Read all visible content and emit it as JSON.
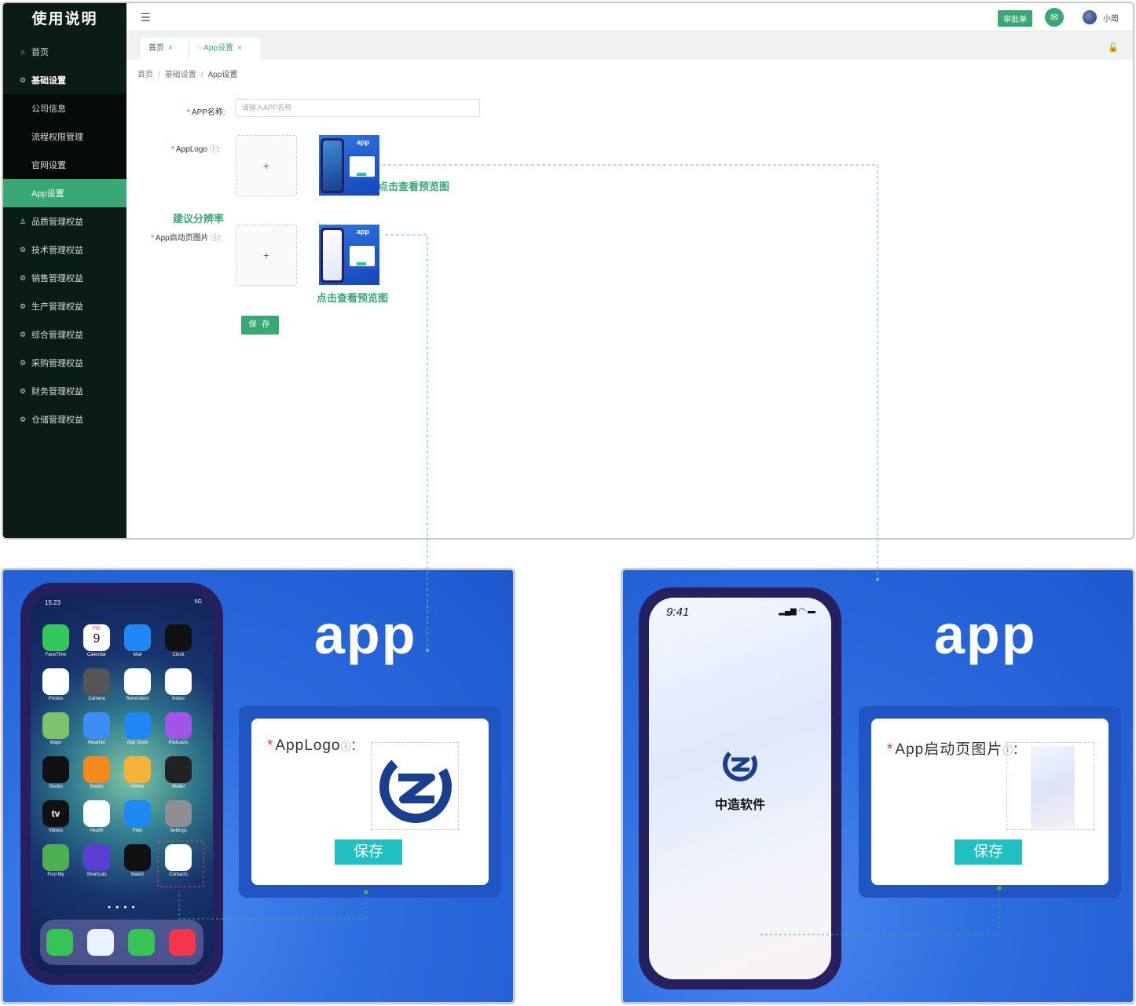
{
  "sidebar": {
    "title": "使用说明",
    "items": [
      {
        "label": "首页",
        "icon": "home-icon"
      },
      {
        "label": "基础设置",
        "icon": "settings-icon"
      },
      {
        "label": "公司信息"
      },
      {
        "label": "流程权限管理"
      },
      {
        "label": "官网设置"
      },
      {
        "label": "App设置"
      },
      {
        "label": "品质管理权益",
        "icon": "user-icon"
      },
      {
        "label": "技术管理权益",
        "icon": "settings-icon"
      },
      {
        "label": "销售管理权益",
        "icon": "settings-icon"
      },
      {
        "label": "生产管理权益",
        "icon": "settings-icon"
      },
      {
        "label": "综合管理权益",
        "icon": "settings-icon"
      },
      {
        "label": "采购管理权益",
        "icon": "settings-icon"
      },
      {
        "label": "财务管理权益",
        "icon": "settings-icon"
      },
      {
        "label": "仓储管理权益",
        "icon": "settings-icon"
      }
    ]
  },
  "topbar": {
    "approval_label": "审批单",
    "username": "小周"
  },
  "tabs": [
    {
      "label": "首页"
    },
    {
      "label": "App设置"
    }
  ],
  "breadcrumb": [
    "首页",
    "基础设置",
    "App设置"
  ],
  "form": {
    "app_name_label": "APP名称:",
    "app_name_placeholder": "请输入APP名称",
    "app_logo_label": "AppLogo",
    "launch_label": "App启动页图片",
    "colon": ":",
    "required_mark": "*",
    "upload_plus": "+",
    "preview_hint": "点击查看预览图",
    "resolution_hint": "建议分辨率",
    "save_label": "保 存",
    "thumb_app": "app"
  },
  "preview_left": {
    "app_word": "app",
    "time": "15:23",
    "status": "5G",
    "card_label": "AppLogo",
    "save_label": "保存",
    "calendar_day": "FRI",
    "calendar_date": "9",
    "apps": [
      "FaceTime",
      "Calendar",
      "Mail",
      "Clock",
      "Photos",
      "Camera",
      "Reminders",
      "Notes",
      "Maps",
      "Weather",
      "App Store",
      "Podcasts",
      "Stocks",
      "Books",
      "Home",
      "Wallet",
      "Videos",
      "Health",
      "Files",
      "Settings",
      "Find My",
      "Shortcuts",
      "Watch",
      "Contacts"
    ],
    "tv_label": "tv"
  },
  "preview_right": {
    "app_word": "app",
    "time": "9:41",
    "brand_name": "中造软件",
    "card_label": "App启动页图片",
    "save_label": "保存"
  },
  "colors": {
    "accent": "#3aa875",
    "sidebar_bg": "#0b1c14",
    "panel_blue": "#2d6ee0",
    "teal_button": "#1fbfc2"
  }
}
